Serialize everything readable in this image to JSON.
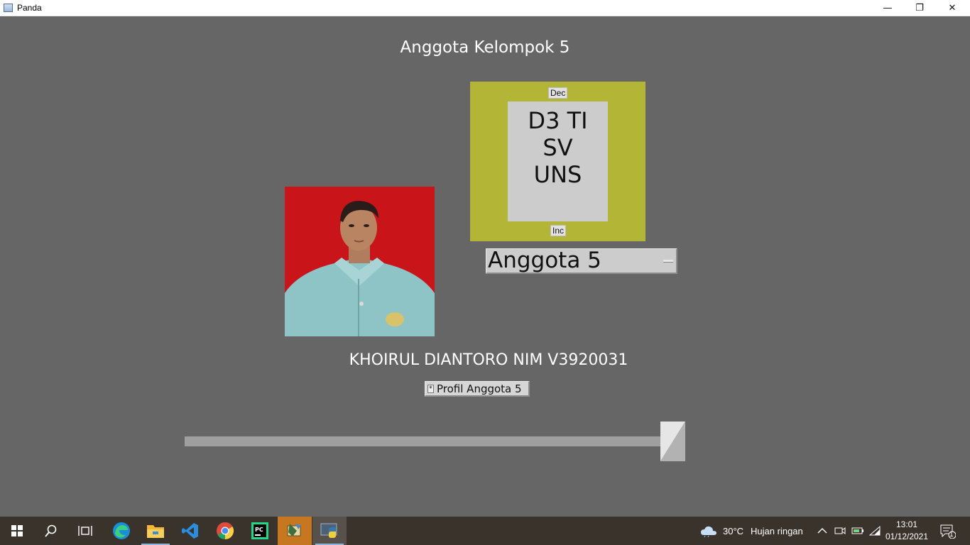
{
  "window": {
    "title": "Panda"
  },
  "window_controls": {
    "minimize": "—",
    "maximize": "❐",
    "close": "✕"
  },
  "app": {
    "heading": "Anggota Kelompok 5",
    "dec_button": "Dec",
    "inc_button": "Inc",
    "scroll_text": [
      "D3 TI",
      "SV",
      "UNS"
    ],
    "member_select": {
      "selected": "Anggota 5"
    },
    "name_label": "KHOIRUL DIANTORO NIM V3920031",
    "profile_button": {
      "mark": "*",
      "label": "Profil Anggota 5"
    },
    "slider": {
      "value_fraction": 0.96
    }
  },
  "taskbar": {
    "apps": [
      "start-icon",
      "search-icon",
      "task-view-icon",
      "edge-icon",
      "file-explorer-icon",
      "vscode-icon",
      "chrome-icon",
      "pycharm-icon",
      "python-idle-icon",
      "python-window-icon"
    ],
    "weather": {
      "temp": "30°C",
      "desc": "Hujan ringan"
    },
    "time": "13:01",
    "date": "01/12/2021",
    "notification_count": "1"
  },
  "colors": {
    "background": "#666666",
    "panel": "#b3b536",
    "taskbar": "#3a332c",
    "photo_bg": "#c9141a",
    "highlight": "#c7771f"
  }
}
